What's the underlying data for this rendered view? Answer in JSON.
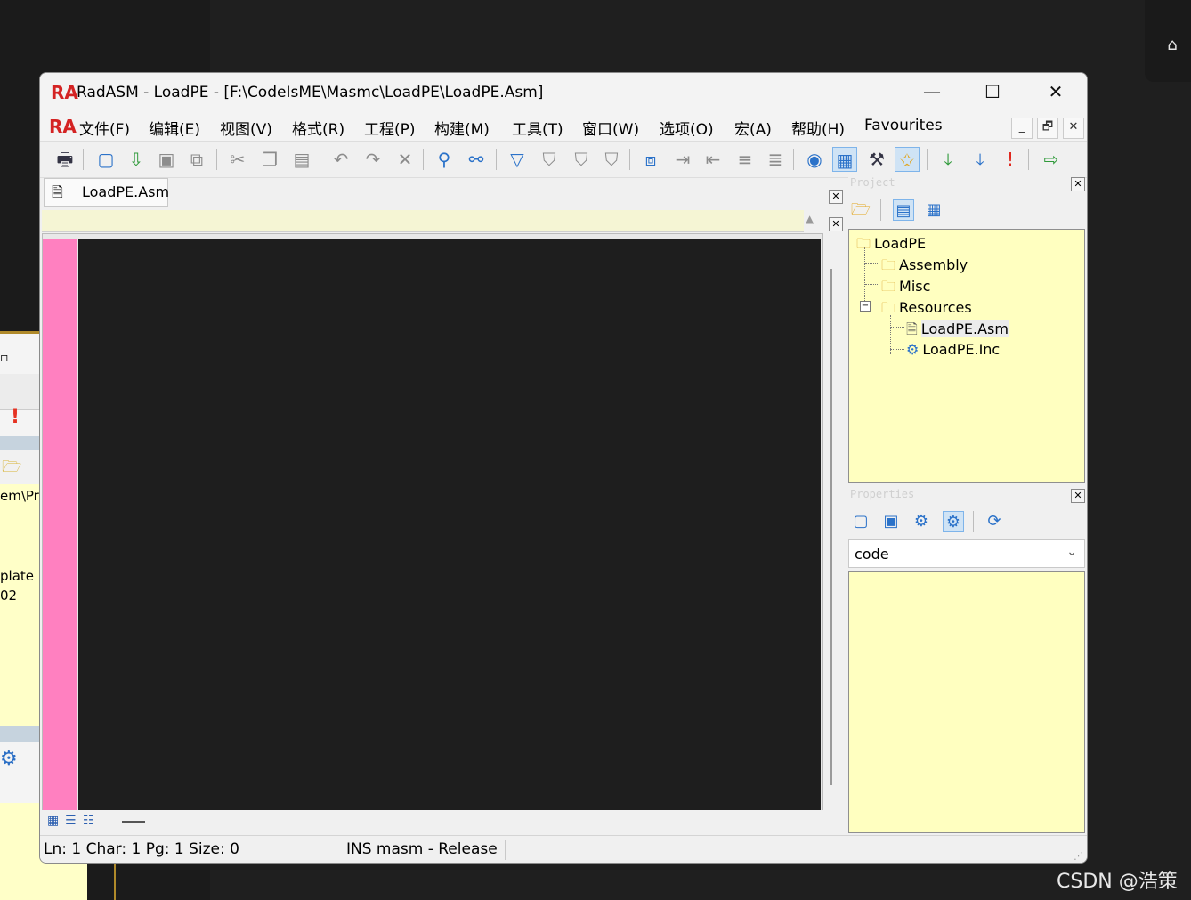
{
  "desktop": {
    "corner_icon": "graduation-cap-icon",
    "watermark": "CSDN @浩策"
  },
  "back_window": {
    "path_fragment": "em\\Pro",
    "text_1": "plate",
    "text_2": "02"
  },
  "window": {
    "app_logo": "RA",
    "title": "RadASM - LoadPE - [F:\\CodeIsME\\Masmc\\LoadPE\\LoadPE.Asm]",
    "minimize": "—",
    "maximize": "☐",
    "close": "✕"
  },
  "menu": {
    "logo": "RA",
    "items": [
      "文件(F)",
      "编辑(E)",
      "视图(V)",
      "格式(R)",
      "工程(P)",
      "构建(M)",
      "工具(T)",
      "窗口(W)",
      "选项(O)",
      "宏(A)",
      "帮助(H)",
      "Favourites"
    ],
    "mdi_minimize": "_",
    "mdi_restore": "🗗",
    "mdi_close": "✕"
  },
  "toolbar": {
    "icons": [
      "print-icon",
      "new-file-icon",
      "open-file-icon",
      "save-icon",
      "save-all-icon",
      "cut-icon",
      "copy-icon",
      "paste-icon",
      "undo-icon",
      "redo-icon",
      "delete-icon",
      "find-icon",
      "replace-icon",
      "bookmark-toggle-icon",
      "bookmark-next-icon",
      "bookmark-prev-icon",
      "bookmark-clear-icon",
      "block-icon",
      "indent-icon",
      "outdent-icon",
      "comment-icon",
      "uncomment-icon",
      "project-browser-icon",
      "output-icon",
      "tools-icon",
      "favourite-icon",
      "assemble-icon",
      "build-icon",
      "go-icon",
      "run-icon"
    ]
  },
  "editor": {
    "tab_label": "LoadPE.Asm",
    "close_glyph": "✕"
  },
  "status": {
    "position": "Ln: 1 Char: 1 Pg: 1 Size: 0",
    "mode": "INS masm - Release"
  },
  "project_pane": {
    "caption": "Project",
    "close_glyph": "✕",
    "tree": [
      {
        "label": "LoadPE",
        "level": 0,
        "icon": "folder-icon"
      },
      {
        "label": "Assembly",
        "level": 1,
        "icon": "folder-icon"
      },
      {
        "label": "Misc",
        "level": 1,
        "icon": "folder-icon"
      },
      {
        "label": "Resources",
        "level": 1,
        "icon": "folder-icon"
      },
      {
        "label": "LoadPE.Asm",
        "level": 2,
        "icon": "asm-file-icon",
        "selected": true
      },
      {
        "label": "LoadPE.Inc",
        "level": 2,
        "icon": "inc-file-icon"
      }
    ]
  },
  "properties_pane": {
    "caption": "Properties",
    "close_glyph": "✕",
    "selected_value": "code"
  }
}
